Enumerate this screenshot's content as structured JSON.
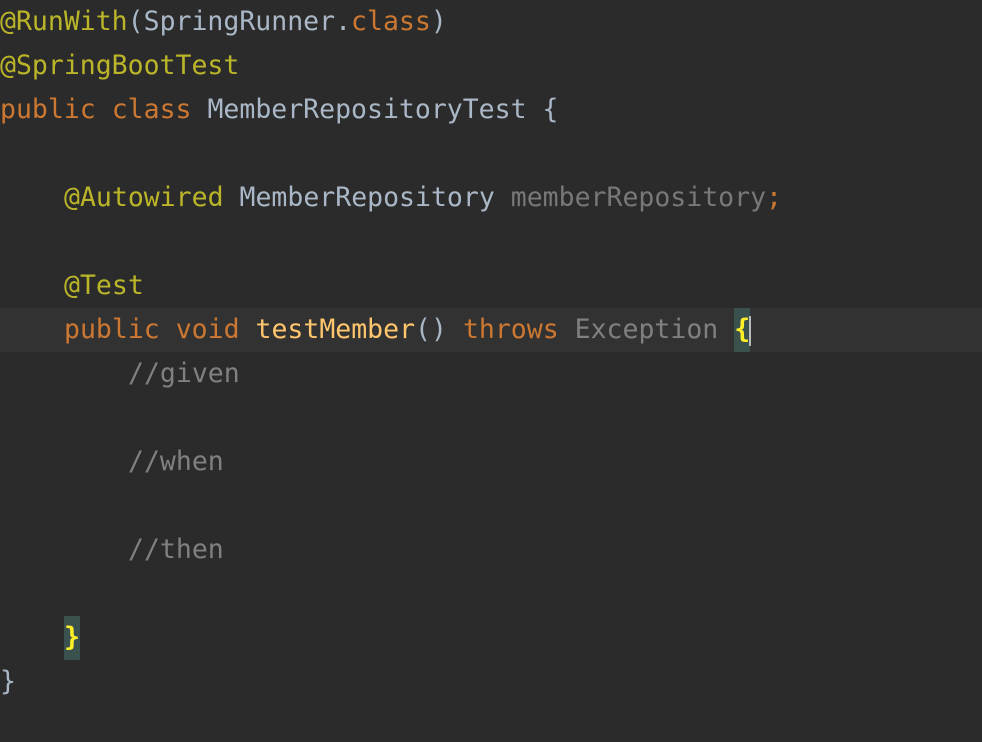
{
  "code": {
    "l1": {
      "annotation": "@RunWith",
      "open_paren": "(",
      "class_ref": "SpringRunner",
      "dot": ".",
      "class_kw": "class",
      "close_paren": ")"
    },
    "l2": {
      "annotation": "@SpringBootTest"
    },
    "l3": {
      "public_kw": "public",
      "class_kw": "class",
      "class_name": "MemberRepositoryTest",
      "brace": "{"
    },
    "l5": {
      "annotation": "@Autowired",
      "type": "MemberRepository",
      "field": "memberRepository",
      "semicolon": ";"
    },
    "l7": {
      "annotation": "@Test"
    },
    "l8": {
      "public_kw": "public",
      "void_kw": "void",
      "method_name": "testMember",
      "parens": "()",
      "throws_kw": "throws",
      "exception": "Exception",
      "brace": "{"
    },
    "l9": {
      "comment": "//given"
    },
    "l11": {
      "comment": "//when"
    },
    "l13": {
      "comment": "//then"
    },
    "l15": {
      "brace": "}"
    },
    "l16": {
      "brace": "}"
    }
  },
  "colors": {
    "background": "#2b2b2b",
    "current_line": "#323232",
    "annotation": "#bbb529",
    "keyword": "#cc7832",
    "identifier": "#a9b7c6",
    "method": "#ffc66d",
    "comment": "#808080",
    "brace_match_bg": "#3b514d",
    "brace_match_fg": "#ffef28"
  }
}
